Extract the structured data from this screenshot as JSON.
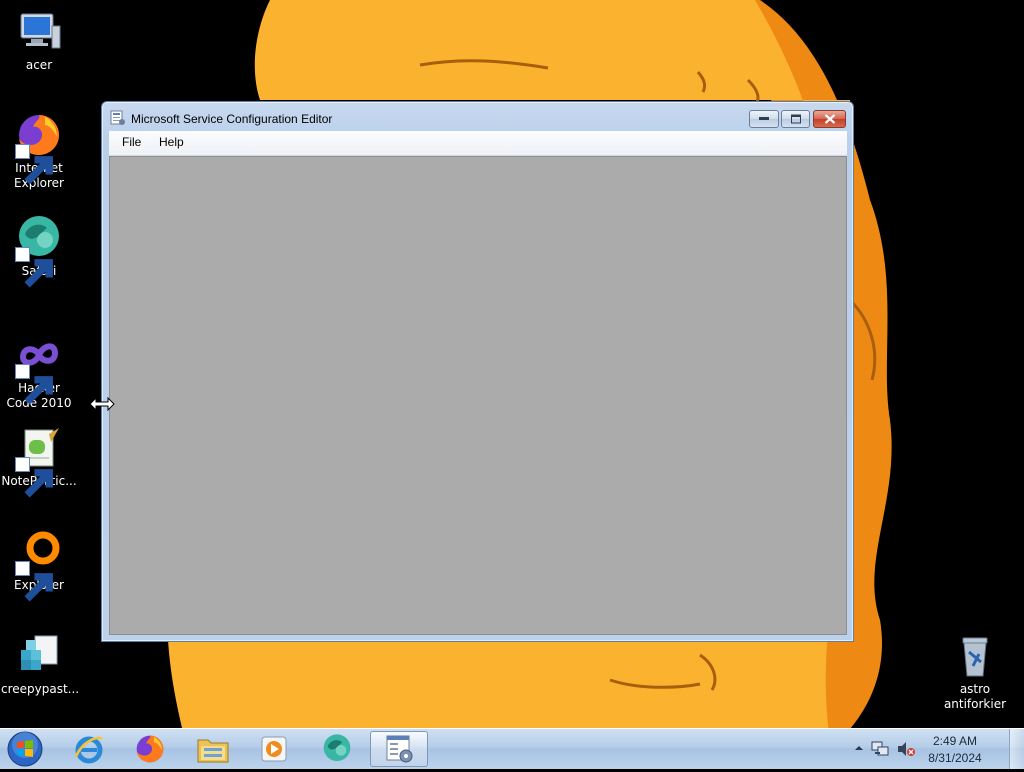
{
  "desktop": {
    "icons": [
      {
        "label": "acer",
        "icon": "computer-icon"
      },
      {
        "label": "Internet Explorer",
        "icon": "firefox-icon"
      },
      {
        "label": "Safari",
        "icon": "globe-icon"
      },
      {
        "label": "Hacker Code 2010",
        "icon": "infinity-icon"
      },
      {
        "label": "NotePolitic...",
        "icon": "notepad-icon"
      },
      {
        "label": "Explorer",
        "icon": "ring-icon"
      },
      {
        "label": "creepypast...",
        "icon": "registry-icon"
      },
      {
        "label": "astro antiforkier",
        "icon": "recycle-bin-icon"
      }
    ]
  },
  "window": {
    "title": "Microsoft Service Configuration Editor",
    "menu": {
      "file": "File",
      "help": "Help"
    }
  },
  "taskbar": {
    "pinned": [
      "start-orb",
      "internet-explorer-icon",
      "firefox-icon",
      "file-explorer-icon",
      "media-player-icon",
      "globe-icon",
      "service-config-editor-icon"
    ],
    "clock": {
      "time": "2:49 AM",
      "date": "8/31/2024"
    }
  },
  "colors": {
    "wallpaper_orange": "#fbb22e",
    "window_client": "#ababab",
    "taskbar": "#b5cde8"
  }
}
